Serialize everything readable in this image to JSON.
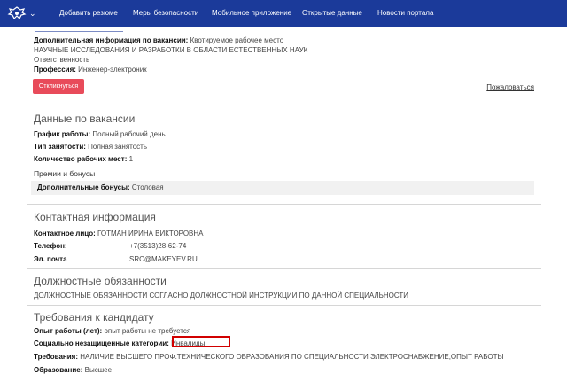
{
  "nav": {
    "items": [
      "Добавить резюме",
      "Меры безопасности",
      "Мобильное приложение",
      "Открытые данные",
      "Новости портала"
    ]
  },
  "vacancy_info": {
    "extra_label": "Дополнительная информация по вакансии",
    "extra_value": "Квотируемое рабочее место",
    "line_institution": "НАУЧНЫЕ ИССЛЕДОВАНИЯ И РАЗРАБОТКИ В ОБЛАСТИ ЕСТЕСТВЕННЫХ НАУК",
    "line_responsibility": "Ответственность",
    "profession_label": "Профессия",
    "profession_value": "Инженер-электроник"
  },
  "actions": {
    "respond": "Откликнуться",
    "complain": "Пожаловаться"
  },
  "vacancy_data": {
    "title": "Данные по вакансии",
    "schedule_label": "График работы",
    "schedule_value": "Полный рабочий день",
    "employment_label": "Тип занятости",
    "employment_value": "Полная занятость",
    "places_label": "Количество рабочих мест",
    "places_value": "1",
    "bonuses_title": "Премии и бонусы",
    "extra_bonus_label": "Дополнительные бонусы",
    "extra_bonus_value": "Столовая"
  },
  "contact": {
    "title": "Контактная информация",
    "person_label": "Контактное лицо",
    "person_value": "ГОТМАН ИРИНА ВИКТОРОВНА",
    "phone_label": "Телефон",
    "phone_value": "+7(3513)28-62-74",
    "email_label": "Эл. почта",
    "email_value": "SRC@MAKEYEV.RU"
  },
  "duties": {
    "title": "Должностные обязанности",
    "text": "ДОЛЖНОСТНЫЕ ОБЯЗАННОСТИ СОГЛАСНО ДОЛЖНОСТНОЙ ИНСТРУКЦИИ ПО ДАННОЙ СПЕЦИАЛЬНОСТИ"
  },
  "requirements": {
    "title": "Требования к кандидату",
    "experience_label": "Опыт работы (лет)",
    "experience_value": "опыт работы не требуется",
    "social_label": "Социально незащищенные категории",
    "social_value": "Инвалиды",
    "req_label": "Требования",
    "req_value": "НАЛИЧИЕ ВЫСШЕГО ПРОФ.ТЕХНИЧЕСКОГО ОБРАЗОВАНИЯ ПО СПЕЦИАЛЬНОСТИ ЭЛЕКТРОСНАБЖЕНИЕ,ОПЫТ РАБОТЫ",
    "education_label": "Образование",
    "education_value": "Высшее"
  },
  "colors": {
    "topbar": "#1b3a9a",
    "button": "#e84b5a",
    "highlight": "#d10000"
  }
}
